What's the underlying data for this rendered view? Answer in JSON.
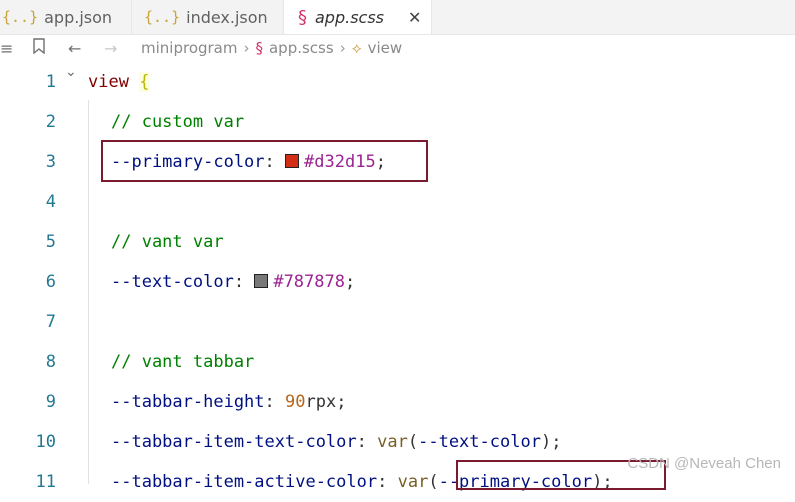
{
  "tabs": [
    {
      "icon": "{..}",
      "label": "app.json"
    },
    {
      "icon": "{..}",
      "label": "index.json"
    },
    {
      "icon": "§",
      "label": "app.scss",
      "close": "✕"
    }
  ],
  "breadcrumb": {
    "folder": "miniprogram",
    "file": "app.scss",
    "symbol": "view"
  },
  "editor": {
    "lines": [
      {
        "n": "1"
      },
      {
        "n": "2"
      },
      {
        "n": "3"
      },
      {
        "n": "4"
      },
      {
        "n": "5"
      },
      {
        "n": "6"
      },
      {
        "n": "7"
      },
      {
        "n": "8"
      },
      {
        "n": "9"
      },
      {
        "n": "10"
      },
      {
        "n": "11"
      }
    ],
    "l1": {
      "sel": "view",
      "brace": "{"
    },
    "l2": {
      "comment": "// custom var"
    },
    "l3": {
      "prop": "--primary-color",
      "colon": ":",
      "hex": "#d32d15",
      "semi": ";",
      "swatch": "#d32d15"
    },
    "l5": {
      "comment": "// vant var"
    },
    "l6": {
      "prop": "--text-color",
      "colon": ":",
      "hex": "#787878",
      "semi": ";",
      "swatch": "#787878"
    },
    "l8": {
      "comment": "// vant tabbar"
    },
    "l9": {
      "prop": "--tabbar-height",
      "colon": ":",
      "num": "90",
      "unit": "rpx",
      "semi": ";"
    },
    "l10": {
      "prop": "--tabbar-item-text-color",
      "colon": ":",
      "fn": "var",
      "open": "(",
      "arg": "--text-color",
      "close": ")",
      "semi": ";"
    },
    "l11": {
      "prop": "--tabbar-item-active-color",
      "colon": ":",
      "fn": "var",
      "open": "(",
      "arg": "--primary-color",
      "close": ")",
      "semi": ";"
    }
  },
  "watermark": "CSDN @Neveah Chen"
}
